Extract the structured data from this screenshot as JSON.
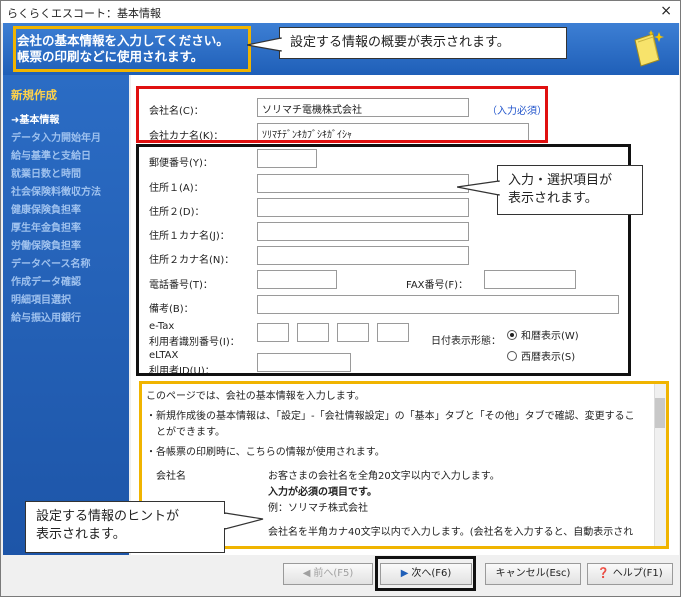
{
  "window": {
    "title": "らくらくエスコート：基本情報",
    "close_glyph": "×"
  },
  "banner": {
    "title": "会社の基本情報を入力してください。\n帳票の印刷などに使用されます。",
    "icon": "sparkle-document-icon"
  },
  "callouts": {
    "overview": "設定する情報の概要が表示されます。",
    "inputs": "入力・選択項目が\n表示されます。",
    "hint": "設定する情報のヒントが\n表示されます。"
  },
  "sidebar": {
    "heading": "新規作成",
    "items": [
      {
        "label": "➜基本情報",
        "active": true
      },
      {
        "label": "データ入力開始年月"
      },
      {
        "label": "給与基準と支給日"
      },
      {
        "label": "就業日数と時間"
      },
      {
        "label": "社会保険料徴収方法"
      },
      {
        "label": "健康保険負担率"
      },
      {
        "label": "厚生年金負担率"
      },
      {
        "label": "労働保険負担率"
      },
      {
        "label": "データベース名称"
      },
      {
        "label": "作成データ確認"
      },
      {
        "label": "明細項目選択"
      },
      {
        "label": "給与振込用銀行"
      }
    ]
  },
  "form": {
    "company_name_label": "会社名(C)：",
    "company_name_value": "ソリマチ電機株式会社",
    "required_note": "（入力必須）",
    "company_kana_label": "会社カナ名(K)：",
    "company_kana_value": "ｿﾘﾏﾁﾃﾞﾝｷｶﾌﾞｼｷｶﾞｲｼｬ",
    "postal_label": "郵便番号(Y)：",
    "address1_label": "住所１(A)：",
    "address2_label": "住所２(D)：",
    "address1_kana_label": "住所１カナ名(J)：",
    "address2_kana_label": "住所２カナ名(N)：",
    "phone_label": "電話番号(T)：",
    "fax_label": "FAX番号(F)：",
    "notes_label": "備考(B)：",
    "etax_label_1": "e-Tax",
    "etax_label_2": "利用者識別番号(I)：",
    "eltax_label_1": "eLTAX",
    "eltax_label_2": "利用者ID(U)：",
    "date_format_label": "日付表示形態：",
    "date_options": [
      {
        "label": "和暦表示(W)",
        "selected": true
      },
      {
        "label": "西暦表示(S)",
        "selected": false
      }
    ]
  },
  "hint": {
    "intro": "このページでは、会社の基本情報を入力します。",
    "bullet1a": "・新規作成後の基本情報は、「設定」-「会社情報設定」の「基本」タブと「その他」タブで確認、変更するこ",
    "bullet1b": "　とができます。",
    "bullet2": "・各帳票の印刷時に、こちらの情報が使用されます。",
    "term": "会社名",
    "desc1": "お客さまの会社名を全角20文字以内で入力します。",
    "desc2": "入力が必須の項目です。",
    "desc3": "例：ソリマチ株式会社",
    "desc4": "会社名を半角カナ40文字以内で入力します。(会社名を入力すると、自動表示され"
  },
  "footer": {
    "prev": "前へ(F5)",
    "next": "次へ(F6)",
    "cancel": "キャンセル(Esc)",
    "help": "ヘルプ(F1)"
  },
  "colors": {
    "red_frame": "#e01010",
    "black_frame": "#111111",
    "yellow_frame": "#f0b400",
    "sidebar_blue": "#2b6cc4"
  }
}
